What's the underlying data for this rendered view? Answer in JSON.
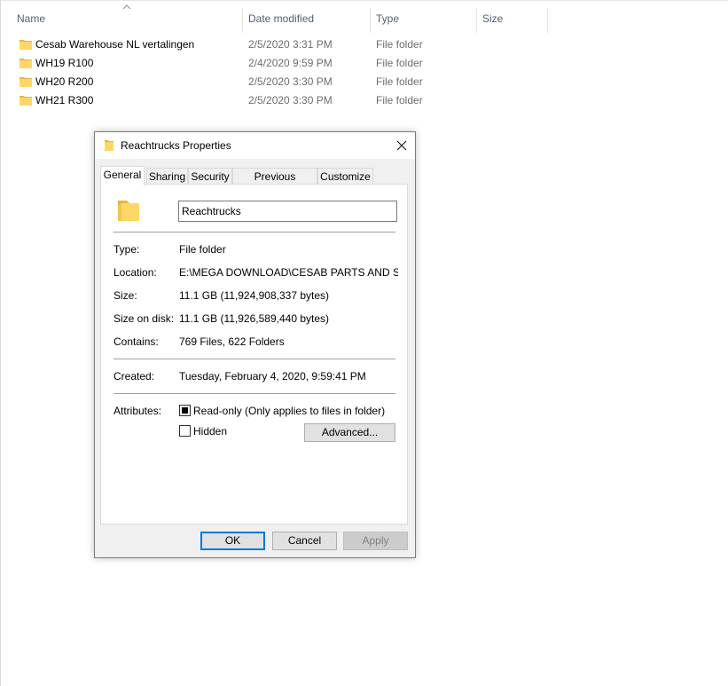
{
  "explorer": {
    "columns": {
      "name": "Name",
      "date": "Date modified",
      "type": "Type",
      "size": "Size"
    },
    "rows": [
      {
        "name": "Cesab Warehouse NL vertalingen",
        "date": "2/5/2020 3:31 PM",
        "type": "File folder"
      },
      {
        "name": "WH19 R100",
        "date": "2/4/2020 9:59 PM",
        "type": "File folder"
      },
      {
        "name": "WH20 R200",
        "date": "2/5/2020 3:30 PM",
        "type": "File folder"
      },
      {
        "name": "WH21 R300",
        "date": "2/5/2020 3:30 PM",
        "type": "File folder"
      }
    ]
  },
  "dialog": {
    "title": "Reachtrucks Properties",
    "tabs": [
      "General",
      "Sharing",
      "Security",
      "Previous Versions",
      "Customize"
    ],
    "folder_name": "Reachtrucks",
    "labels": {
      "type": "Type:",
      "location": "Location:",
      "size": "Size:",
      "size_on_disk": "Size on disk:",
      "contains": "Contains:",
      "created": "Created:",
      "attributes": "Attributes:"
    },
    "values": {
      "type": "File folder",
      "location": "E:\\MEGA DOWNLOAD\\CESAB PARTS AND SERVICE",
      "size": "11.1 GB (11,924,908,337 bytes)",
      "size_on_disk": "11.1 GB (11,926,589,440 bytes)",
      "contains": "769 Files, 622 Folders",
      "created": "Tuesday, February 4, 2020, 9:59:41 PM"
    },
    "attributes": {
      "readonly_label": "Read-only (Only applies to files in folder)",
      "readonly_state": "indeterminate",
      "hidden_label": "Hidden",
      "hidden_state": "unchecked",
      "advanced_label": "Advanced..."
    },
    "buttons": {
      "ok": "OK",
      "cancel": "Cancel",
      "apply": "Apply"
    }
  },
  "colors": {
    "folder_yellow": "#ffd766",
    "folder_dark": "#e5b640",
    "accent": "#0078d7",
    "header_text": "#4c607a"
  }
}
